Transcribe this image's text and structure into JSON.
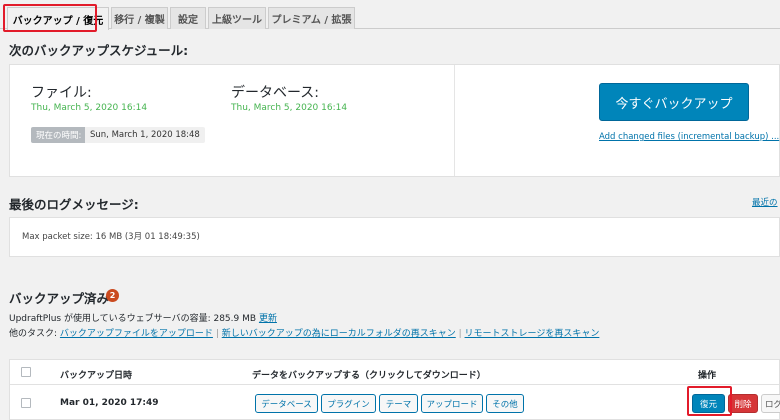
{
  "tabs": [
    {
      "label": "バックアップ / 復元"
    },
    {
      "label": "移行 / 複製"
    },
    {
      "label": "設定"
    },
    {
      "label": "上級ツール"
    },
    {
      "label": "プレミアム / 拡張"
    }
  ],
  "schedule": {
    "heading": "次のバックアップスケジュール:",
    "files_label": "ファイル:",
    "files_date": "Thu, March 5, 2020 16:14",
    "db_label": "データベース:",
    "db_date": "Thu, March 5, 2020 16:14",
    "now_label": "現在の時間:",
    "now_value": "Sun, March 1, 2020 18:48",
    "backup_now": "今すぐバックアップ",
    "incremental_link": "Add changed files (incremental backup) ..."
  },
  "log": {
    "heading": "最後のログメッセージ:",
    "latest_link": "最近の",
    "message": "Max packet size: 16 MB (3月 01 18:49:35)"
  },
  "existing": {
    "heading": "バックアップ済み",
    "count": "2",
    "usage_prefix": "UpdraftPlus が使用しているウェブサーバの容量: 285.9 MB",
    "refresh": "更新",
    "other_tasks": "他のタスク:",
    "task1": "バックアップファイルをアップロード",
    "task2": "新しいバックアップの為にローカルフォルダの再スキャン",
    "task3": "リモートストレージを再スキャン",
    "sep": "|"
  },
  "table": {
    "col_date": "バックアップ日時",
    "col_data": "データをバックアップする（クリックしてダウンロード）",
    "col_actions": "操作",
    "rows": [
      {
        "date": "Mar 01, 2020 17:49",
        "components": [
          "データベース",
          "プラグイン",
          "テーマ",
          "アップロード",
          "その他"
        ],
        "restore": "復元",
        "delete": "削除",
        "log": "ログ"
      }
    ]
  },
  "colors": {
    "primary": "#0085ba",
    "success": "#46b450",
    "danger": "#d63638",
    "highlight": "#e21b2a"
  }
}
